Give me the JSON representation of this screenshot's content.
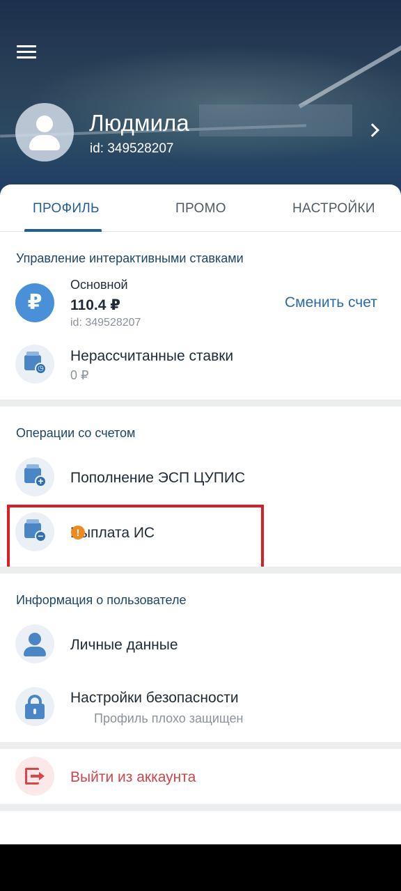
{
  "header": {
    "user_name": "Людмила",
    "user_id": "id: 349528207"
  },
  "tabs": [
    {
      "label": "ПРОФИЛЬ",
      "active": true
    },
    {
      "label": "ПРОМО",
      "active": false
    },
    {
      "label": "НАСТРОЙКИ",
      "active": false
    }
  ],
  "interactive_bets": {
    "title": "Управление интерактивными ставками",
    "account": {
      "name": "Основной",
      "balance": "110.4 ₽",
      "id": "id: 349528207",
      "currency_symbol": "₽",
      "change_label": "Сменить счет"
    },
    "unsettled": {
      "label": "Нерассчитанные ставки",
      "value": "0 ₽"
    }
  },
  "operations": {
    "title": "Операции со счетом",
    "deposit_label": "Пополнение ЭСП ЦУПИС",
    "withdraw_label": "Выплата ИС"
  },
  "user_info": {
    "title": "Информация о пользователе",
    "personal_label": "Личные данные",
    "security_label": "Настройки безопасности",
    "security_warning": "Профиль плохо защищен",
    "warning_glyph": "!"
  },
  "logout": {
    "label": "Выйти из аккаунта"
  },
  "colors": {
    "accent": "#1f5d94",
    "icon_blue": "#4a86c6",
    "danger": "#c9474b",
    "warning": "#ec8b21",
    "highlight": "#d81f26"
  }
}
